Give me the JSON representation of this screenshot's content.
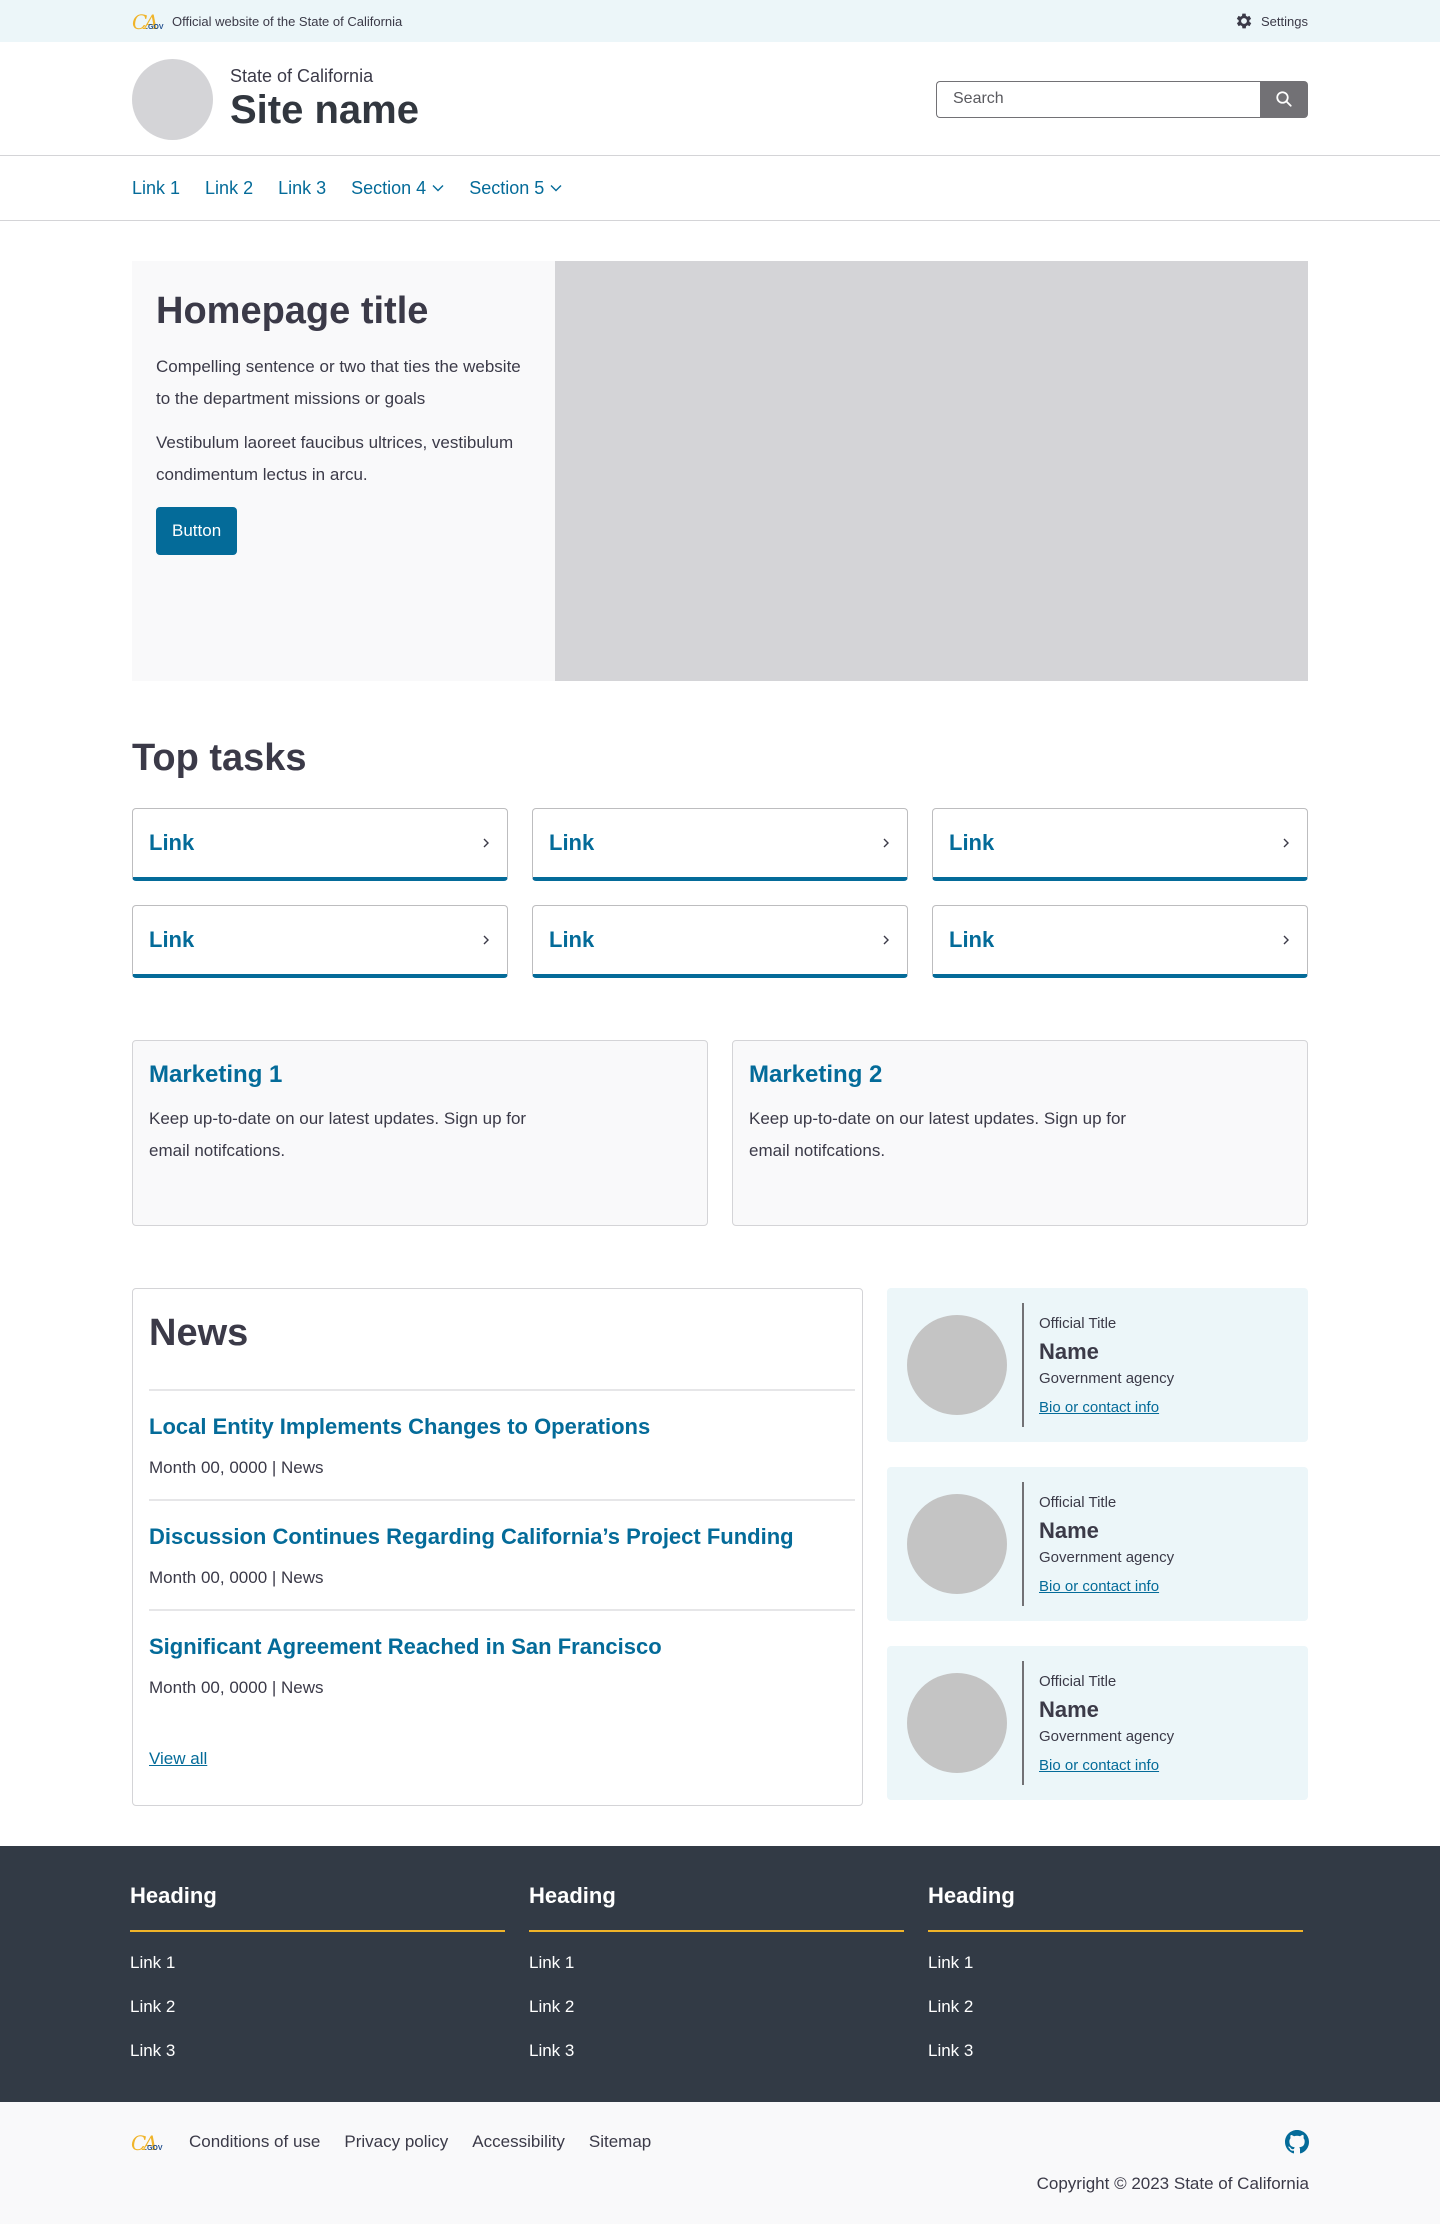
{
  "utility": {
    "logo_text": "CA",
    "logo_suffix": ".GOV",
    "official_text": "Official website of the State of California",
    "settings_label": "Settings"
  },
  "branding": {
    "state": "State of California",
    "site_name": "Site name",
    "search_placeholder": "Search"
  },
  "nav": {
    "items": [
      {
        "label": "Link 1",
        "dropdown": false
      },
      {
        "label": "Link 2",
        "dropdown": false
      },
      {
        "label": "Link 3",
        "dropdown": false
      },
      {
        "label": "Section 4",
        "dropdown": true
      },
      {
        "label": "Section 5",
        "dropdown": true
      }
    ]
  },
  "hero": {
    "title": "Homepage title",
    "paragraph1": "Compelling sentence or two that ties the website to the department missions or goals",
    "paragraph2": "Vestibulum laoreet faucibus ultrices, vestibulum condimentum lectus in arcu.",
    "button_label": "Button"
  },
  "top_tasks": {
    "title": "Top tasks",
    "items": [
      "Link",
      "Link",
      "Link",
      "Link",
      "Link",
      "Link"
    ]
  },
  "marketing": [
    {
      "title": "Marketing 1",
      "body": "Keep up-to-date on our latest updates. Sign up for email notifcations."
    },
    {
      "title": "Marketing 2",
      "body": "Keep up-to-date on our latest updates. Sign up for email notifcations."
    }
  ],
  "news": {
    "title": "News",
    "items": [
      {
        "title": "Local Entity Implements Changes to Operations",
        "meta": "Month 00, 0000 | News"
      },
      {
        "title": "Discussion Continues Regarding California’s Project Funding",
        "meta": "Month 00, 0000 | News"
      },
      {
        "title": "Significant Agreement Reached in San Francisco",
        "meta": "Month 00, 0000 | News"
      }
    ],
    "view_all": "View all"
  },
  "officials": [
    {
      "title": "Official Title",
      "name": "Name",
      "agency": "Government agency",
      "link": "Bio or contact info"
    },
    {
      "title": "Official Title",
      "name": "Name",
      "agency": "Government agency",
      "link": "Bio or contact info"
    },
    {
      "title": "Official Title",
      "name": "Name",
      "agency": "Government agency",
      "link": "Bio or contact info"
    }
  ],
  "site_footer": {
    "columns": [
      {
        "heading": "Heading",
        "links": [
          "Link 1",
          "Link 2",
          "Link 3"
        ]
      },
      {
        "heading": "Heading",
        "links": [
          "Link 1",
          "Link 2",
          "Link 3"
        ]
      },
      {
        "heading": "Heading",
        "links": [
          "Link 1",
          "Link 2",
          "Link 3"
        ]
      }
    ]
  },
  "global_footer": {
    "links": [
      "Conditions of use",
      "Privacy policy",
      "Accessibility",
      "Sitemap"
    ],
    "copyright": "Copyright © 2023 State of California"
  },
  "colors": {
    "primary": "#046b99",
    "accent": "#f0b429",
    "dark": "#323a45",
    "utility_bg": "#ecf6f9"
  }
}
